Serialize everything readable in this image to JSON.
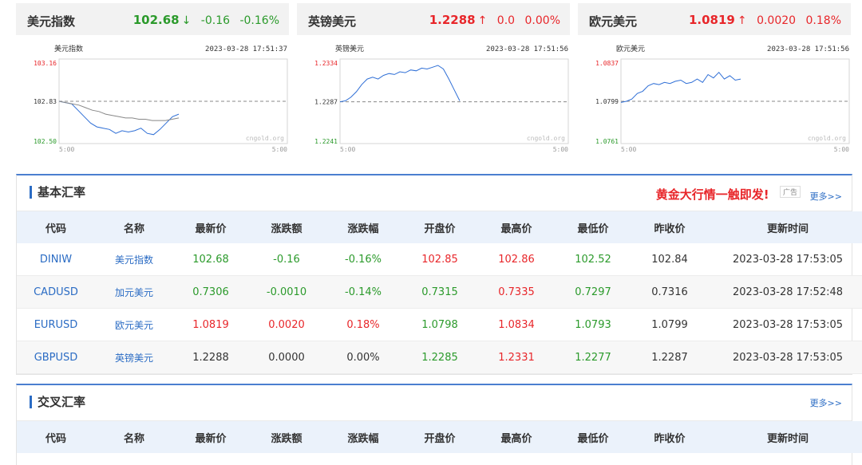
{
  "cards": [
    {
      "name": "美元指数",
      "price": "102.68",
      "arrow": "↓",
      "change": "-0.16",
      "pct": "-0.16%",
      "dir": "down",
      "chart_title": "美元指数",
      "timestamp": "2023-03-28 17:51:37",
      "y_top": "103.16",
      "y_mid": "102.83",
      "y_bot": "102.50",
      "x_start": "5:00",
      "x_end": "5:00",
      "watermark": "cngold.org"
    },
    {
      "name": "英镑美元",
      "price": "1.2288",
      "arrow": "↑",
      "change": "0.0",
      "pct": "0.00%",
      "dir": "up",
      "chart_title": "英镑美元",
      "timestamp": "2023-03-28 17:51:56",
      "y_top": "1.2334",
      "y_mid": "1.2287",
      "y_bot": "1.2241",
      "x_start": "5:00",
      "x_end": "5:00",
      "watermark": "cngold.org"
    },
    {
      "name": "欧元美元",
      "price": "1.0819",
      "arrow": "↑",
      "change": "0.0020",
      "pct": "0.18%",
      "dir": "up",
      "chart_title": "欧元美元",
      "timestamp": "2023-03-28 17:51:56",
      "y_top": "1.0837",
      "y_mid": "1.0799",
      "y_bot": "1.0761",
      "x_start": "5:00",
      "x_end": "5:00",
      "watermark": "cngold.org"
    }
  ],
  "basic": {
    "title": "基本汇率",
    "promo": "黄金大行情一触即发!",
    "ad": "广告",
    "more": "更多>>",
    "headers": [
      "代码",
      "名称",
      "最新价",
      "涨跌额",
      "涨跌幅",
      "开盘价",
      "最高价",
      "最低价",
      "昨收价",
      "更新时间"
    ],
    "rows": [
      {
        "code": "DINIW",
        "name": "美元指数",
        "last": "102.68",
        "chg": "-0.16",
        "pct": "-0.16%",
        "open": "102.85",
        "high": "102.86",
        "low": "102.52",
        "prev": "102.84",
        "time": "2023-03-28 17:53:05",
        "c": {
          "last": "down",
          "chg": "down",
          "pct": "down",
          "open": "up",
          "high": "up",
          "low": "down"
        }
      },
      {
        "code": "CADUSD",
        "name": "加元美元",
        "last": "0.7306",
        "chg": "-0.0010",
        "pct": "-0.14%",
        "open": "0.7315",
        "high": "0.7335",
        "low": "0.7297",
        "prev": "0.7316",
        "time": "2023-03-28 17:52:48",
        "c": {
          "last": "down",
          "chg": "down",
          "pct": "down",
          "open": "down",
          "high": "up",
          "low": "down"
        }
      },
      {
        "code": "EURUSD",
        "name": "欧元美元",
        "last": "1.0819",
        "chg": "0.0020",
        "pct": "0.18%",
        "open": "1.0798",
        "high": "1.0834",
        "low": "1.0793",
        "prev": "1.0799",
        "time": "2023-03-28 17:53:05",
        "c": {
          "last": "up",
          "chg": "up",
          "pct": "up",
          "open": "down",
          "high": "up",
          "low": "down"
        }
      },
      {
        "code": "GBPUSD",
        "name": "英镑美元",
        "last": "1.2288",
        "chg": "0.0000",
        "pct": "0.00%",
        "open": "1.2285",
        "high": "1.2331",
        "low": "1.2277",
        "prev": "1.2287",
        "time": "2023-03-28 17:53:05",
        "c": {
          "last": "flat",
          "chg": "flat",
          "pct": "flat",
          "open": "down",
          "high": "up",
          "low": "down"
        }
      }
    ]
  },
  "cross": {
    "title": "交叉汇率",
    "more": "更多>>",
    "headers": [
      "代码",
      "名称",
      "最新价",
      "涨跌额",
      "涨跌幅",
      "开盘价",
      "最高价",
      "最低价",
      "昨收价",
      "更新时间"
    ]
  },
  "chart_data": [
    {
      "type": "line",
      "title": "美元指数",
      "ylim": [
        102.5,
        103.16
      ],
      "reference": 102.83,
      "x": [
        "5:00",
        "5:00"
      ],
      "series": [
        {
          "values": [
            102.83,
            102.82,
            102.81,
            102.76,
            102.71,
            102.66,
            102.63,
            102.62,
            102.61,
            102.58,
            102.6,
            102.59,
            102.6,
            102.62,
            102.58,
            102.57,
            102.61,
            102.66,
            102.71,
            102.73
          ]
        },
        {
          "values": [
            102.83,
            102.82,
            102.81,
            102.8,
            102.78,
            102.76,
            102.75,
            102.73,
            102.72,
            102.71,
            102.7,
            102.7,
            102.69,
            102.69,
            102.68,
            102.68,
            102.68,
            102.69,
            102.7
          ]
        }
      ]
    },
    {
      "type": "line",
      "title": "英镑美元",
      "ylim": [
        1.2241,
        1.2334
      ],
      "reference": 1.2287,
      "x": [
        "5:00",
        "5:00"
      ],
      "series": [
        {
          "values": [
            1.2287,
            1.2288,
            1.2292,
            1.2298,
            1.2306,
            1.2312,
            1.2314,
            1.2312,
            1.2316,
            1.2318,
            1.2317,
            1.232,
            1.2319,
            1.2322,
            1.2321,
            1.2324,
            1.2323,
            1.2325,
            1.2327,
            1.2323,
            1.2312,
            1.23,
            1.2288
          ]
        }
      ]
    },
    {
      "type": "line",
      "title": "欧元美元",
      "ylim": [
        1.0761,
        1.0837
      ],
      "reference": 1.0799,
      "x": [
        "5:00",
        "5:00"
      ],
      "series": [
        {
          "values": [
            1.0798,
            1.0799,
            1.0801,
            1.0806,
            1.0808,
            1.0813,
            1.0815,
            1.0814,
            1.0816,
            1.0815,
            1.0817,
            1.0818,
            1.0815,
            1.0816,
            1.0819,
            1.0816,
            1.0823,
            1.082,
            1.0825,
            1.0819,
            1.0822,
            1.0818,
            1.0819
          ]
        }
      ]
    }
  ]
}
